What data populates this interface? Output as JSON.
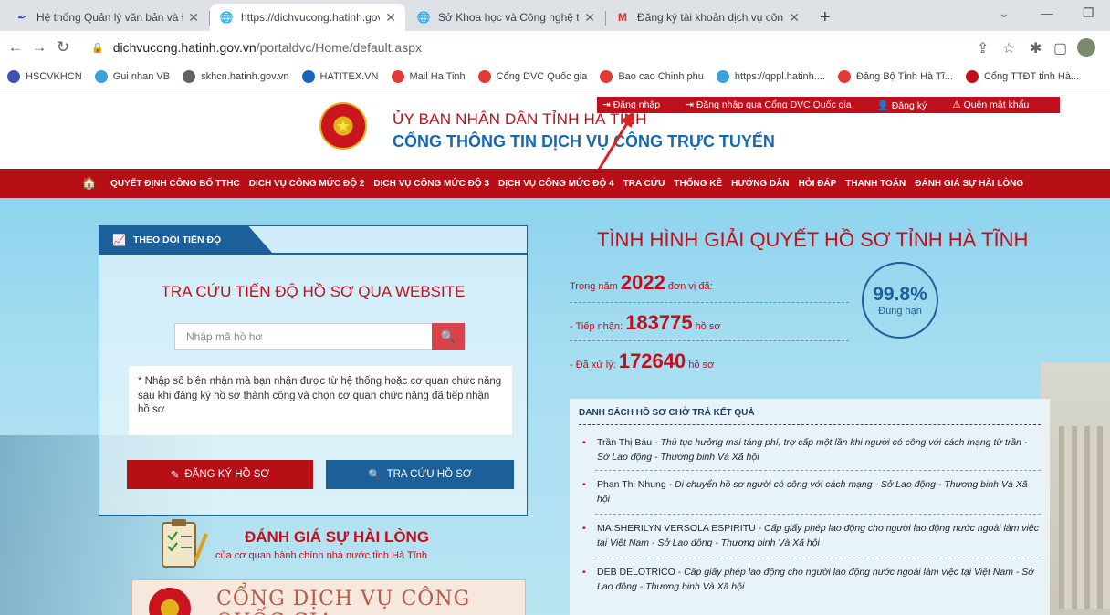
{
  "browser": {
    "tabs": [
      {
        "title": "Hệ thống Quản lý văn bản và Điề",
        "icon": "feather-icon",
        "active": false
      },
      {
        "title": "https://dichvucong.hatinh.gov.vn",
        "icon": "globe-icon",
        "active": true
      },
      {
        "title": "Sở Khoa học và Công nghệ tỉnh H",
        "icon": "globe-icon",
        "active": false
      },
      {
        "title": "Đăng ký tài khoản dịch vụ công t",
        "icon": "gmail-icon",
        "active": false
      }
    ],
    "url_domain": "dichvucong.hatinh.gov.vn",
    "url_path": "/portaldvc/Home/default.aspx",
    "bookmarks": [
      {
        "label": "HSCVKHCN",
        "color": "#3f51b5"
      },
      {
        "label": "Gui nhan VB",
        "color": "#3aa0d8"
      },
      {
        "label": "skhcn.hatinh.gov.vn",
        "color": "#5f6368"
      },
      {
        "label": "HATITEX.VN",
        "color": "#1565c0"
      },
      {
        "label": "Mail Ha Tinh",
        "color": "#e53935"
      },
      {
        "label": "Cổng DVC Quốc gia",
        "color": "#e53935"
      },
      {
        "label": "Bao cao Chinh phu",
        "color": "#e53935"
      },
      {
        "label": "https://qppl.hatinh....",
        "color": "#3aa0d8"
      },
      {
        "label": "Đảng Bộ Tỉnh Hà Tĩ...",
        "color": "#e53935"
      },
      {
        "label": "Cổng TTĐT tỉnh Hà...",
        "color": "#c0101b"
      }
    ]
  },
  "topnav": {
    "login": "Đăng nhập",
    "login_national": "Đăng nhập qua Cổng DVC Quốc gia",
    "register": "Đăng ký",
    "forgot": "Quên mật khẩu"
  },
  "header": {
    "line1": "ỦY BAN NHÂN DÂN TỈNH HÀ TĨNH",
    "line2": "CỔNG THÔNG TIN DỊCH VỤ CÔNG TRỰC TUYẾN"
  },
  "mainnav": [
    "QUYẾT ĐỊNH CÔNG BỐ TTHC",
    "DỊCH VỤ CÔNG MỨC ĐỘ 2",
    "DỊCH VỤ CÔNG MỨC ĐỘ 3",
    "DỊCH VỤ CÔNG MỨC ĐỘ 4",
    "TRA CỨU",
    "THỐNG KÊ",
    "HƯỚNG DẪN",
    "HỎI ĐÁP",
    "THANH TOÁN",
    "ĐÁNH GIÁ SỰ HÀI LÒNG"
  ],
  "tracking": {
    "tab_label": "THEO DÕI TIẾN ĐỘ",
    "title": "TRA CỨU TIẾN ĐỘ HỒ SƠ QUA WEBSITE",
    "search_placeholder": "Nhập mã hồ hơ",
    "note": "* Nhập số biên nhận mà bạn nhận được từ hệ thống hoặc cơ quan chức năng sau khi đăng ký hồ sơ thành công và chọn cơ quan chức năng đã tiếp nhận hồ sơ",
    "register_btn": "ĐĂNG KÝ HỒ SƠ",
    "lookup_btn": "TRA CỨU HỒ SƠ"
  },
  "stats": {
    "title": "TÌNH HÌNH GIẢI QUYẾT HỒ SƠ TỈNH HÀ TĨNH",
    "year_prefix": "Trong năm",
    "year": "2022",
    "year_suffix": "đơn vị đã:",
    "received_prefix": "- Tiếp nhận:",
    "received": "183775",
    "received_unit": "hồ sơ",
    "processed_prefix": "- Đã xử lý:",
    "processed": "172640",
    "processed_unit": "hồ sơ",
    "ontime_pct": "99.8%",
    "ontime_label": "Đúng hạn"
  },
  "results": {
    "title": "DANH SÁCH HỒ SƠ CHỜ TRẢ KẾT QUẢ",
    "items": [
      {
        "name": "Trần Thị Báu",
        "text": "  -  Thủ tục hưởng mai táng phí, trợ cấp một lần khi người có công với cách mạng từ trần  -  Sở Lao động - Thương binh Và Xã hội"
      },
      {
        "name": "Phan Thị Nhung",
        "text": "  -  Di chuyển hồ sơ người có công với cách mạng  -  Sở Lao động - Thương binh Và Xã hội"
      },
      {
        "name": "MA.SHERILYN VERSOLA ESPIRITU",
        "text": "  -  Cấp giấy phép lao động cho người lao động nước ngoài làm việc tại Việt Nam  -  Sở Lao động - Thương binh Và Xã hội"
      },
      {
        "name": "DEB DELOTRICO",
        "text": "  -  Cấp giấy phép lao động cho người lao động nước ngoài làm việc tại Việt Nam  -  Sở Lao động - Thương binh Và Xã hội"
      }
    ]
  },
  "survey": {
    "title": "ĐÁNH GIÁ SỰ HÀI LÒNG",
    "subtitle": "của cơ quan hành chính nhà nước tỉnh Hà Tĩnh"
  },
  "banner": {
    "text": "CỔNG DỊCH VỤ CÔNG QUỐC GIA"
  }
}
